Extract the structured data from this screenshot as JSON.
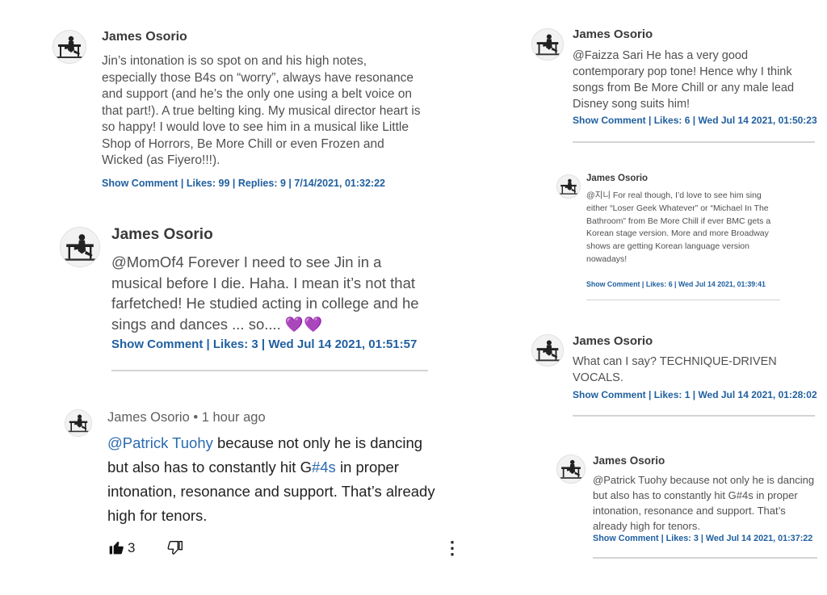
{
  "comments": [
    {
      "author": "James Osorio",
      "text": "Jin’s intonation is so spot on and his high notes, especially those B4s on “worry”, always have resonance and support (and he’s the only one using a belt voice on that part!). A true belting king. My musical director heart is so happy! I would love to see him in a musical like Little Shop of Horrors, Be More Chill or even Frozen and Wicked (as Fiyero!!!).",
      "show_comment": "Show Comment",
      "likes": "Likes: 99",
      "replies": "Replies: 9",
      "date": "7/14/2021, 01:32:22"
    },
    {
      "author": "James Osorio",
      "text": "@MomOf4 Forever I need to see Jin in a musical before I die. Haha. I mean it’s not that farfetched! He studied acting in college and he sings and dances ... so.... 💜💜",
      "show_comment": "Show Comment",
      "likes": "Likes: 3",
      "date": "Wed Jul 14 2021, 01:51:57"
    },
    {
      "author": "James Osorio",
      "time_ago": "• 1 hour ago",
      "mention": "@Patrick Tuohy",
      "text_a": " because not only he is dancing but also has to constantly hit G",
      "hashtag": "#4s",
      "text_b": " in proper intonation, resonance and support. That’s already high for tenors.",
      "like_count": "3",
      "more": "⋮"
    },
    {
      "author": "James Osorio",
      "text": "@Faizza Sari He has a very good contemporary pop tone! Hence why I think songs from Be More Chill or any male lead Disney song suits him!",
      "show_comment": "Show Comment",
      "likes": "Likes: 6",
      "date": "Wed Jul 14 2021, 01:50:23"
    },
    {
      "author": "James Osorio",
      "text": "@지니 For real though, I’d love to see him sing either “Loser Geek Whatever” or “Michael In The Bathroom” from Be More Chill if ever BMC gets a Korean stage version. More and more Broadway shows are getting Korean language version nowadays!",
      "show_comment": "Show Comment",
      "likes": "Likes: 6",
      "date": "Wed Jul 14 2021, 01:39:41"
    },
    {
      "author": "James Osorio",
      "text": "What can I say? TECHNIQUE-DRIVEN VOCALS.",
      "show_comment": "Show Comment",
      "likes": "Likes: 1",
      "date": "Wed Jul 14 2021, 01:28:02"
    },
    {
      "author": "James Osorio",
      "text": "@Patrick Tuohy because not only he is dancing but also has to constantly hit G#4s in proper intonation, resonance and support. That’s already high for tenors.",
      "show_comment": "Show Comment",
      "likes": "Likes: 3",
      "date": "Wed Jul 14 2021, 01:37:22"
    }
  ],
  "separator": " | ",
  "colors": {
    "link": "#1f5f9f",
    "mention": "#2a6bb0",
    "divider": "#d4d4d4"
  }
}
